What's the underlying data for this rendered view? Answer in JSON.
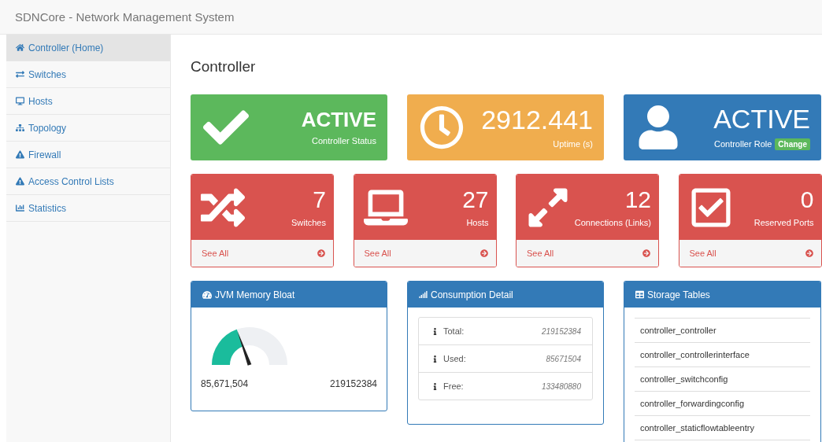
{
  "app_title": "SDNCore - Network Management System",
  "sidebar": {
    "items": [
      {
        "label": "Controller (Home)",
        "selected": true
      },
      {
        "label": "Switches",
        "selected": false
      },
      {
        "label": "Hosts",
        "selected": false
      },
      {
        "label": "Topology",
        "selected": false
      },
      {
        "label": "Firewall",
        "selected": false
      },
      {
        "label": "Access Control Lists",
        "selected": false
      },
      {
        "label": "Statistics",
        "selected": false
      }
    ]
  },
  "page_title": "Controller",
  "status_tiles": [
    {
      "value": "ACTIVE",
      "label": "Controller Status",
      "color": "#5cb85c"
    },
    {
      "value": "2912.441",
      "label": "Uptime (s)",
      "color": "#f0ad4e"
    },
    {
      "value": "ACTIVE",
      "label": "Controller Role",
      "color": "#337ab7",
      "action": "Change"
    }
  ],
  "count_tiles": [
    {
      "value": "7",
      "label": "Switches",
      "link": "See All"
    },
    {
      "value": "27",
      "label": "Hosts",
      "link": "See All"
    },
    {
      "value": "12",
      "label": "Connections (Links)",
      "link": "See All"
    },
    {
      "value": "0",
      "label": "Reserved Ports",
      "link": "See All"
    }
  ],
  "memory_panel": {
    "title": "JVM Memory Bloat",
    "used": "85,671,504",
    "total": "219152384"
  },
  "consumption_panel": {
    "title": "Consumption Detail",
    "rows": [
      {
        "label": "Total:",
        "value": "219152384"
      },
      {
        "label": "Used:",
        "value": "85671504"
      },
      {
        "label": "Free:",
        "value": "133480880"
      }
    ]
  },
  "storage_panel": {
    "title": "Storage Tables",
    "items": [
      "controller_controller",
      "controller_controllerinterface",
      "controller_switchconfig",
      "controller_forwardingconfig",
      "controller_staticflowtableentry"
    ]
  }
}
